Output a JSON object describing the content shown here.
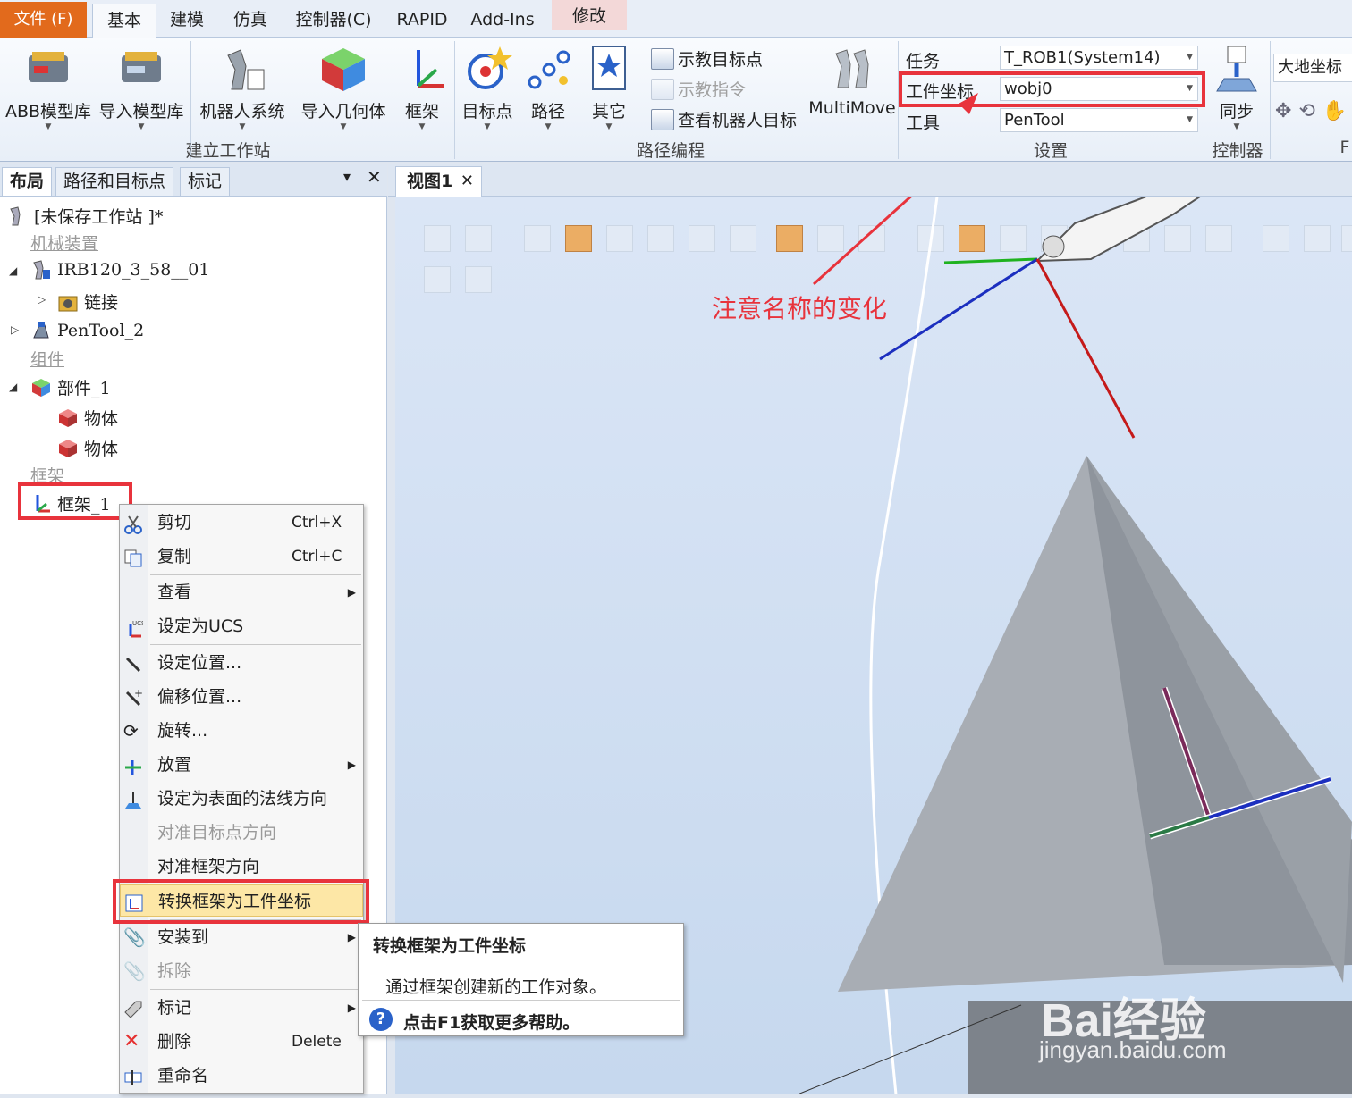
{
  "tabs": {
    "file": "文件 (F)",
    "basic": "基本",
    "modeling": "建模",
    "simulation": "仿真",
    "controller": "控制器(C)",
    "rapid": "RAPID",
    "addins": "Add-Ins",
    "modify": "修改"
  },
  "ribbon": {
    "abb_library": "ABB模型库",
    "import_library": "导入模型库",
    "robot_system": "机器人系统",
    "import_geometry": "导入几何体",
    "frame": "框架",
    "group_build": "建立工作站",
    "target": "目标点",
    "path": "路径",
    "other": "其它",
    "teach_target": "示教目标点",
    "teach_instruction": "示教指令",
    "view_robot_target": "查看机器人目标",
    "multimove": "MultiMove",
    "group_path": "路径编程",
    "task_label": "任务",
    "task_value": "T_ROB1(System14)",
    "workobj_label": "工件坐标",
    "workobj_value": "wobj0",
    "tool_label": "工具",
    "tool_value": "PenTool",
    "group_settings": "设置",
    "sync": "同步",
    "group_controller": "控制器",
    "world_coord": "大地坐标",
    "group_f": "F"
  },
  "left_panel": {
    "tabs": [
      "布局",
      "路径和目标点",
      "标记"
    ],
    "station": "[未保存工作站 ]*",
    "section_mech": "机械装置",
    "robot": "IRB120_3_58__01",
    "links": "链接",
    "tool": "PenTool_2",
    "section_components": "组件",
    "part": "部件_1",
    "body1": "物体",
    "body2": "物体",
    "section_frames": "框架",
    "frame": "框架_1"
  },
  "context_menu": {
    "cut": "剪切",
    "cut_key": "Ctrl+X",
    "copy": "复制",
    "copy_key": "Ctrl+C",
    "view": "查看",
    "set_ucs": "设定为UCS",
    "set_position": "设定位置...",
    "offset_position": "偏移位置...",
    "rotate": "旋转...",
    "place": "放置",
    "set_normal": "设定为表面的法线方向",
    "align_target": "对准目标点方向",
    "align_frame": "对准框架方向",
    "convert": "转换框架为工件坐标",
    "attach": "安装到",
    "detach": "拆除",
    "mark": "标记",
    "delete": "删除",
    "delete_key": "Delete",
    "rename": "重命名"
  },
  "tooltip": {
    "title": "转换框架为工件坐标",
    "desc": "通过框架创建新的工作对象。",
    "help": "点击F1获取更多帮助。"
  },
  "viewport": {
    "tab": "视图1",
    "annotation": "注意名称的变化"
  },
  "watermark": {
    "brand": "Bai经验",
    "url": "jingyan.baidu.com"
  },
  "colors": {
    "file_tab": "#e26a1c",
    "highlight_box": "#e8333c",
    "annotation": "#e8333c",
    "menu_highlight": "#fde7a6"
  }
}
